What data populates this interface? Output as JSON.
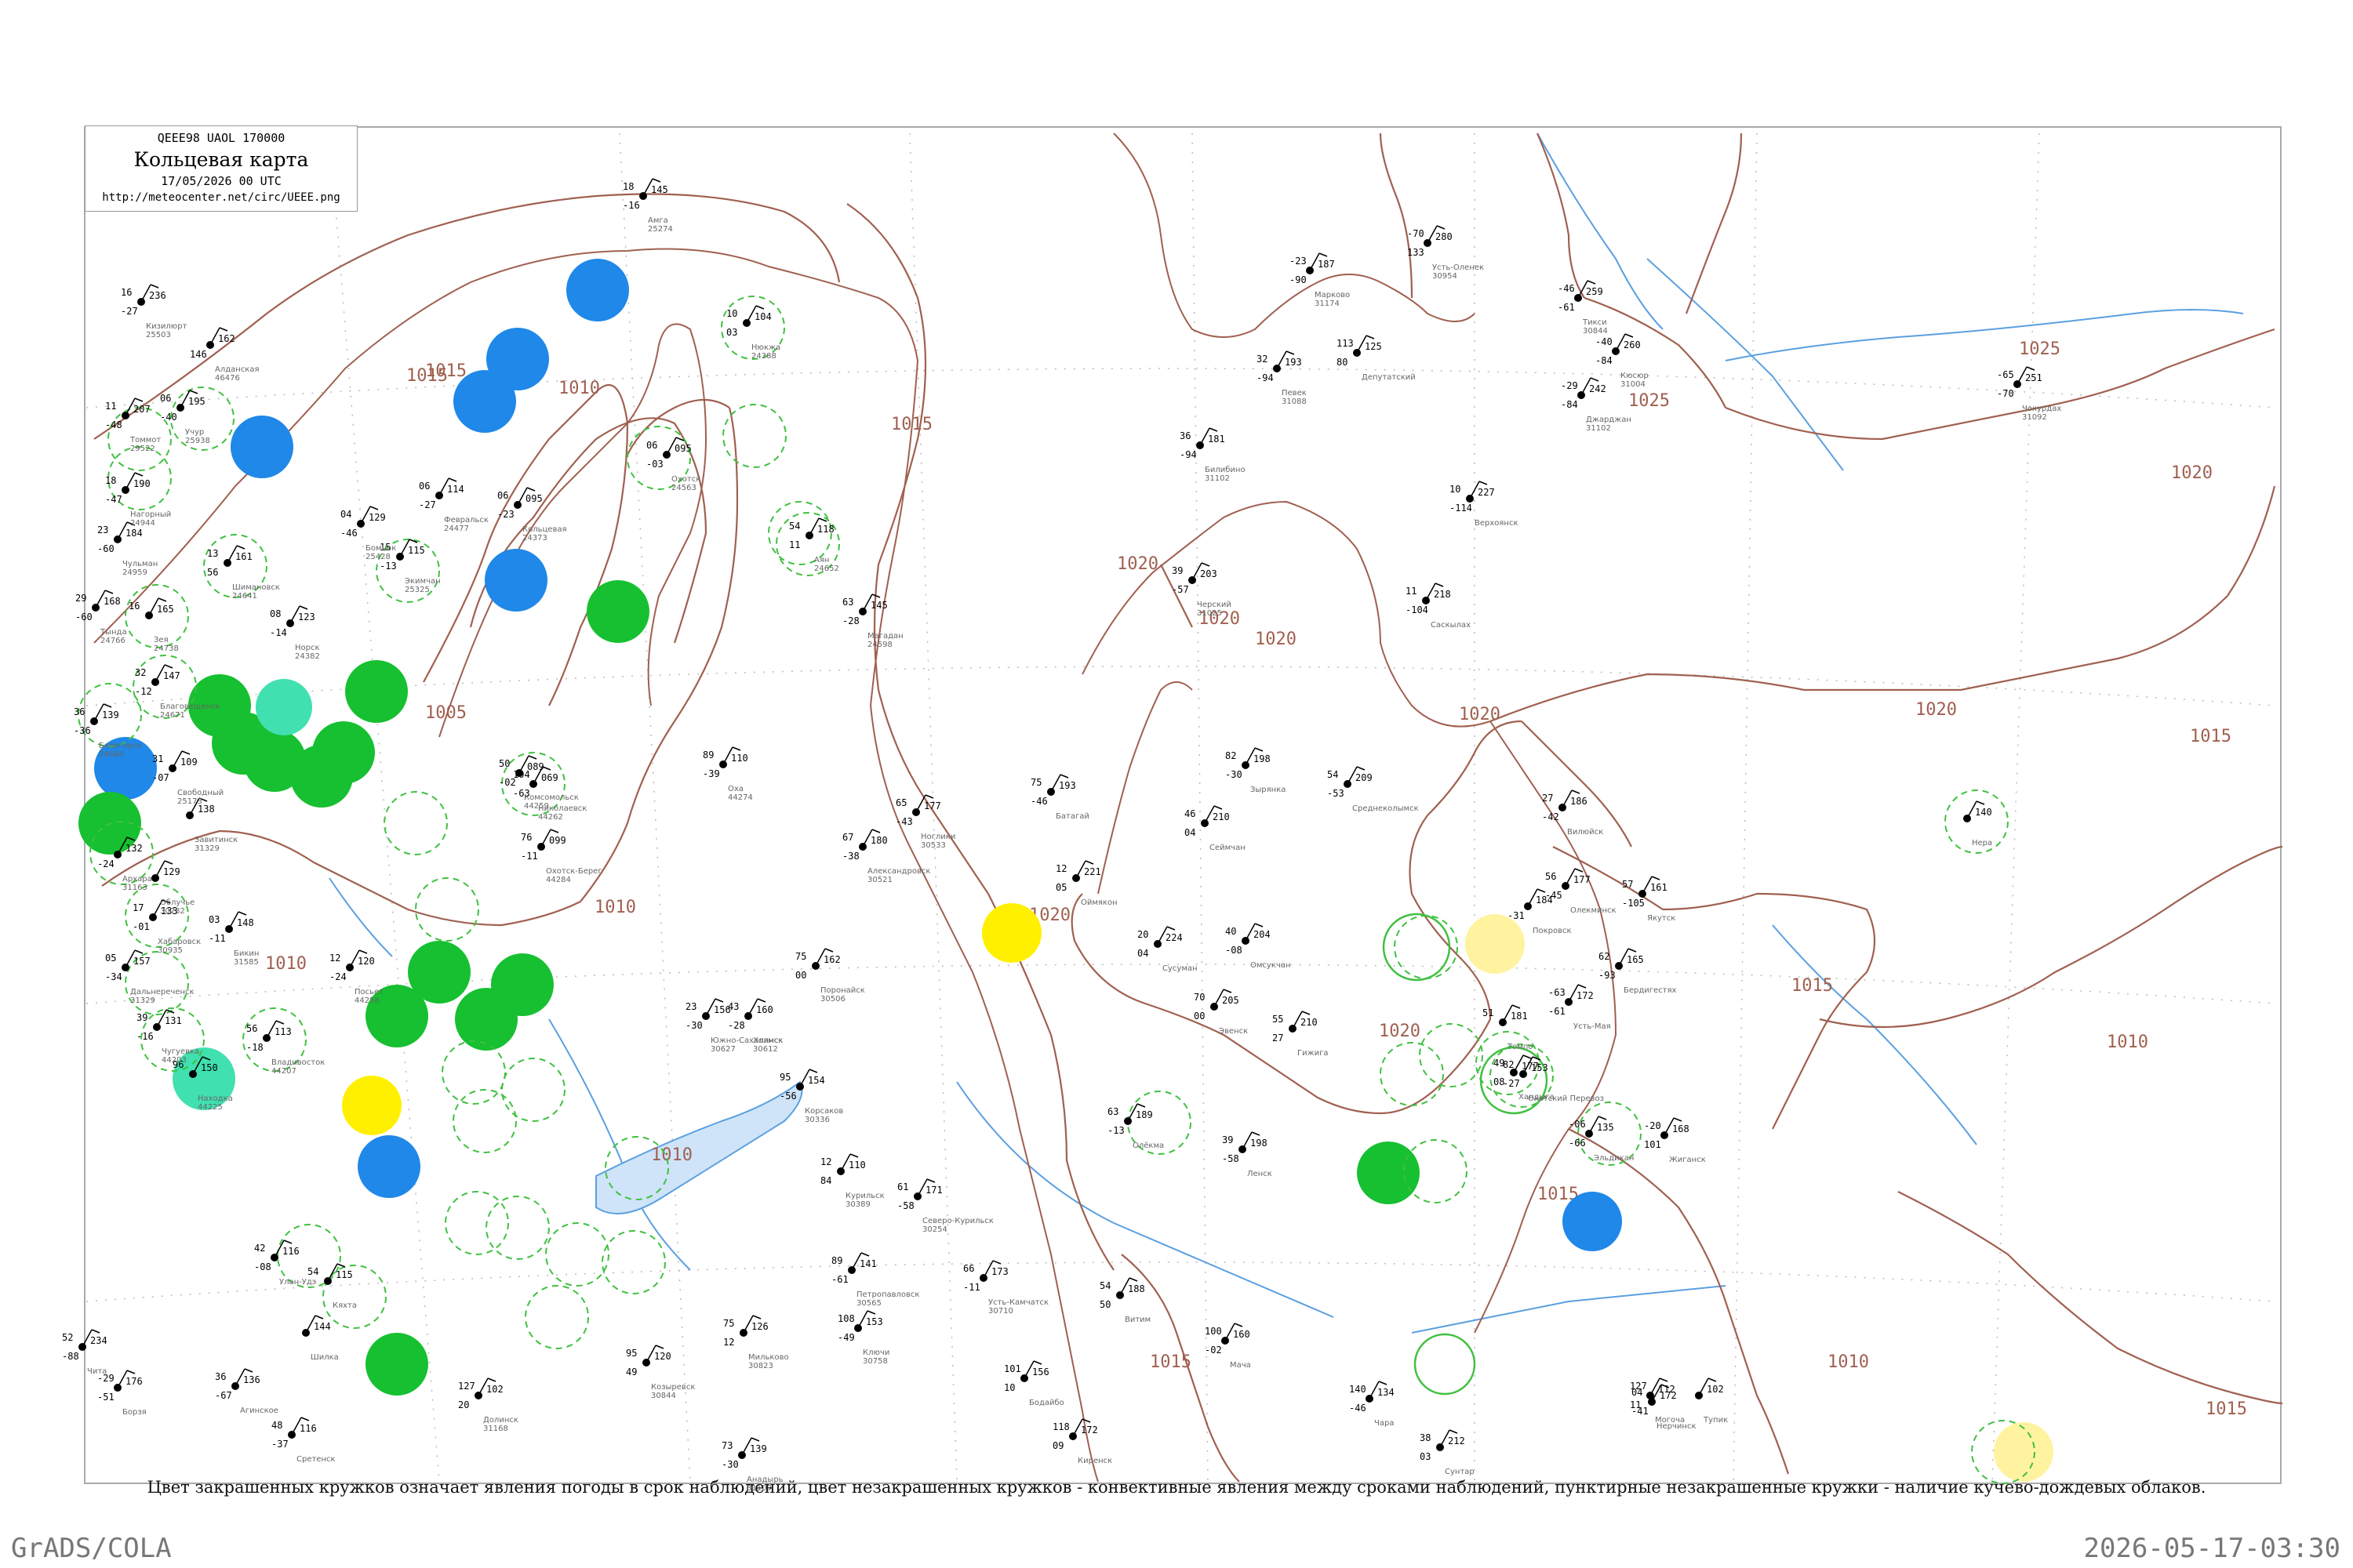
{
  "header": {
    "code_line": "QEEE98  UAOL  170000",
    "title": "Кольцевая карта",
    "date": "17/05/2026 00 UTC",
    "url": "http://meteocenter.net/circ/UEEE.png"
  },
  "legend_text": "Цвет закрашенных кружков означает явления погоды в срок наблюдений, цвет незакрашенных кружков - конвективные явления между сроками наблюдений, пунктирные незакрашенные кружки - наличие кучево-дождевых облаков.",
  "footer": {
    "left": "GrADS/COLA",
    "right": "2026-05-17-03:30"
  },
  "colors": {
    "isobar": "#a06050",
    "water": "#5aa0e0",
    "rain_green": "#16c030",
    "snow_blue": "#1f88e8",
    "fog_yellow": "#fff000",
    "haze_lightyellow": "#fff3a0",
    "cb_dashed": "#40c040",
    "teal": "#40e0b0"
  },
  "isobar_labels": [
    "1005",
    "1010",
    "1010",
    "1010",
    "1015",
    "1015",
    "1020",
    "1020",
    "1020",
    "1020",
    "1020",
    "1020",
    "1015",
    "1010",
    "1020",
    "1025",
    "1025",
    "1020",
    "1015",
    "1015",
    "1015",
    "1010",
    "1010",
    "1015",
    "1015"
  ],
  "stations": [
    {
      "name": "Амга",
      "pressure": "145",
      "temp": "18",
      "dew": "-16"
    },
    {
      "name": "Кизилюрт",
      "pressure": "236",
      "temp": "16",
      "dew": "-27"
    },
    {
      "name": "Алданская",
      "pressure": "162",
      "temp": "",
      "dew": "146"
    },
    {
      "name": "Томмот",
      "pressure": "207",
      "temp": "11",
      "dew": "-48"
    },
    {
      "name": "Учур",
      "pressure": "195",
      "temp": "06",
      "dew": "-40"
    },
    {
      "name": "Нагорный",
      "pressure": "190",
      "temp": "18",
      "dew": "-47"
    },
    {
      "name": "Чульман",
      "pressure": "184",
      "temp": "23",
      "dew": "-60"
    },
    {
      "name": "Тында",
      "pressure": "168",
      "temp": "29",
      "dew": "-60"
    },
    {
      "name": "Зея",
      "pressure": "165",
      "temp": "16",
      "dew": ""
    },
    {
      "name": "Шимановск",
      "pressure": "161",
      "temp": "13",
      "dew": "56"
    },
    {
      "name": "Бомнак",
      "pressure": "129",
      "temp": "04",
      "dew": "-46"
    },
    {
      "name": "Экимчан",
      "pressure": "115",
      "temp": "15",
      "dew": "-13"
    },
    {
      "name": "Норск",
      "pressure": "123",
      "temp": "08",
      "dew": "-14"
    },
    {
      "name": "Февральск",
      "pressure": "114",
      "temp": "06",
      "dew": "-27"
    },
    {
      "name": "Кольцевая",
      "pressure": "095",
      "temp": "06",
      "dew": "-23"
    },
    {
      "name": "Нюкжа",
      "pressure": "104",
      "temp": "10",
      "dew": "03"
    },
    {
      "name": "Охотск",
      "pressure": "095",
      "temp": "06",
      "dew": "-03"
    },
    {
      "name": "Аян",
      "pressure": "118",
      "temp": "54",
      "dew": "11"
    },
    {
      "name": "Магадан",
      "pressure": "145",
      "temp": "63",
      "dew": "-28"
    },
    {
      "name": "Благовещенск",
      "pressure": "147",
      "temp": "32",
      "dew": "-12"
    },
    {
      "name": "Белогорск",
      "pressure": "139",
      "temp": "36",
      "dew": "-36"
    },
    {
      "name": "Свободный",
      "pressure": "109",
      "temp": "31",
      "dew": "-07"
    },
    {
      "name": "Завитинск",
      "pressure": "138",
      "temp": "",
      "dew": ""
    },
    {
      "name": "Архара",
      "pressure": "132",
      "temp": "",
      "dew": "-24"
    },
    {
      "name": "Облучье",
      "pressure": "129",
      "temp": "",
      "dew": ""
    },
    {
      "name": "Хабаровск",
      "pressure": "133",
      "temp": "17",
      "dew": "-01"
    },
    {
      "name": "Бикин",
      "pressure": "148",
      "temp": "03",
      "dew": "-11"
    },
    {
      "name": "Дальнереченск",
      "pressure": "157",
      "temp": "05",
      "dew": "-34"
    },
    {
      "name": "Чугуевка",
      "pressure": "131",
      "temp": "39",
      "dew": "-16"
    },
    {
      "name": "Владивосток",
      "pressure": "113",
      "temp": "56",
      "dew": "-18"
    },
    {
      "name": "Находка",
      "pressure": "150",
      "temp": "96",
      "dew": ""
    },
    {
      "name": "Посьет",
      "pressure": "120",
      "temp": "12",
      "dew": "-24"
    },
    {
      "name": "Комсомольск",
      "pressure": "089",
      "temp": "50",
      "dew": "-02"
    },
    {
      "name": "Николаевск",
      "pressure": "069",
      "temp": "104",
      "dew": "-63"
    },
    {
      "name": "Охотск-Берег",
      "pressure": "099",
      "temp": "76",
      "dew": "-11"
    },
    {
      "name": "Оха",
      "pressure": "110",
      "temp": "89",
      "dew": "-39"
    },
    {
      "name": "Ноглики",
      "pressure": "177",
      "temp": "65",
      "dew": "-43"
    },
    {
      "name": "Александровск",
      "pressure": "180",
      "temp": "67",
      "dew": "-38"
    },
    {
      "name": "Поронайск",
      "pressure": "162",
      "temp": "75",
      "dew": "00"
    },
    {
      "name": "Холмск",
      "pressure": "160",
      "temp": "43",
      "dew": "-28"
    },
    {
      "name": "Южно-Сахалинск",
      "pressure": "156",
      "temp": "23",
      "dew": "-30"
    },
    {
      "name": "Корсаков",
      "pressure": "154",
      "temp": "95",
      "dew": "-56"
    },
    {
      "name": "Курильск",
      "pressure": "110",
      "temp": "12",
      "dew": "84"
    },
    {
      "name": "Северо-Курильск",
      "pressure": "171",
      "temp": "61",
      "dew": "-58"
    },
    {
      "name": "Петропавловск",
      "pressure": "141",
      "temp": "89",
      "dew": "-61"
    },
    {
      "name": "Усть-Камчатск",
      "pressure": "173",
      "temp": "66",
      "dew": "-11"
    },
    {
      "name": "Ключи",
      "pressure": "153",
      "temp": "108",
      "dew": "-49"
    },
    {
      "name": "Мильково",
      "pressure": "126",
      "temp": "75",
      "dew": "12"
    },
    {
      "name": "Козыревск",
      "pressure": "120",
      "temp": "95",
      "dew": "49"
    },
    {
      "name": "Долинск",
      "pressure": "102",
      "temp": "127",
      "dew": "20"
    },
    {
      "name": "Анадырь",
      "pressure": "139",
      "temp": "73",
      "dew": "-30"
    },
    {
      "name": "Марково",
      "pressure": "187",
      "temp": "-23",
      "dew": "-90"
    },
    {
      "name": "Певек",
      "pressure": "193",
      "temp": "32",
      "dew": "-94"
    },
    {
      "name": "Билибино",
      "pressure": "181",
      "temp": "36",
      "dew": "-94"
    },
    {
      "name": "Черский",
      "pressure": "203",
      "temp": "39",
      "dew": "-57"
    },
    {
      "name": "Усть-Оленек",
      "pressure": "280",
      "temp": "-70",
      "dew": "133"
    },
    {
      "name": "Тикси",
      "pressure": "259",
      "temp": "-46",
      "dew": "-61"
    },
    {
      "name": "Кюсюр",
      "pressure": "260",
      "temp": "-40",
      "dew": "-84"
    },
    {
      "name": "Джарджан",
      "pressure": "242",
      "temp": "-29",
      "dew": "-84"
    },
    {
      "name": "Чокурдах",
      "pressure": "251",
      "temp": "-65",
      "dew": "-70"
    },
    {
      "name": "Депутатский",
      "pressure": "125",
      "temp": "113",
      "dew": "80"
    },
    {
      "name": "Верхоянск",
      "pressure": "227",
      "temp": "10",
      "dew": "-114"
    },
    {
      "name": "Саскылах",
      "pressure": "218",
      "temp": "11",
      "dew": "-104"
    },
    {
      "name": "Батагай",
      "pressure": "193",
      "temp": "75",
      "dew": "-46"
    },
    {
      "name": "Зырянка",
      "pressure": "198",
      "temp": "82",
      "dew": "-30"
    },
    {
      "name": "Среднеколымск",
      "pressure": "209",
      "temp": "54",
      "dew": "-53"
    },
    {
      "name": "Сеймчан",
      "pressure": "210",
      "temp": "46",
      "dew": "04"
    },
    {
      "name": "Оймякон",
      "pressure": "221",
      "temp": "12",
      "dew": "05"
    },
    {
      "name": "Сусуман",
      "pressure": "224",
      "temp": "20",
      "dew": "04"
    },
    {
      "name": "Омсукчан",
      "pressure": "204",
      "temp": "40",
      "dew": "-08"
    },
    {
      "name": "Эвенск",
      "pressure": "205",
      "temp": "70",
      "dew": "00"
    },
    {
      "name": "Гижига",
      "pressure": "210",
      "temp": "55",
      "dew": "27"
    },
    {
      "name": "Вилюйск",
      "pressure": "186",
      "temp": "27",
      "dew": "-42"
    },
    {
      "name": "Олекминск",
      "pressure": "177",
      "temp": "56",
      "dew": "-45"
    },
    {
      "name": "Якутск",
      "pressure": "161",
      "temp": "57",
      "dew": "-105"
    },
    {
      "name": "Покровск",
      "pressure": "184",
      "temp": "",
      "dew": "-31"
    },
    {
      "name": "Бердигестях",
      "pressure": "165",
      "temp": "62",
      "dew": "-93"
    },
    {
      "name": "Усть-Мая",
      "pressure": "172",
      "temp": "-63",
      "dew": "-61"
    },
    {
      "name": "Томпо",
      "pressure": "181",
      "temp": "51",
      "dew": ""
    },
    {
      "name": "Хандыга",
      "pressure": "177",
      "temp": "49",
      "dew": "08"
    },
    {
      "name": "Охотский Перевоз",
      "pressure": "153",
      "temp": "82",
      "dew": "-27"
    },
    {
      "name": "Эльдикан",
      "pressure": "135",
      "temp": "-06",
      "dew": "-66"
    },
    {
      "name": "Жиганск",
      "pressure": "168",
      "temp": "-20",
      "dew": "101"
    },
    {
      "name": "Нера",
      "pressure": "140",
      "temp": "",
      "dew": ""
    },
    {
      "name": "Сунтар",
      "pressure": "212",
      "temp": "38",
      "dew": "03"
    },
    {
      "name": "Ленск",
      "pressure": "198",
      "temp": "39",
      "dew": "-58"
    },
    {
      "name": "Олёкма",
      "pressure": "189",
      "temp": "63",
      "dew": "-13"
    },
    {
      "name": "Витим",
      "pressure": "188",
      "temp": "54",
      "dew": "50"
    },
    {
      "name": "Мача",
      "pressure": "160",
      "temp": "100",
      "dew": "-02"
    },
    {
      "name": "Бодайбо",
      "pressure": "156",
      "temp": "101",
      "dew": "10"
    },
    {
      "name": "Киренск",
      "pressure": "172",
      "temp": "118",
      "dew": "09"
    },
    {
      "name": "Чара",
      "pressure": "134",
      "temp": "140",
      "dew": "-46"
    },
    {
      "name": "Могоча",
      "pressure": "112",
      "temp": "127",
      "dew": "11"
    },
    {
      "name": "Тупик",
      "pressure": "102",
      "temp": "",
      "dew": ""
    },
    {
      "name": "Нерчинск",
      "pressure": "172",
      "temp": "04",
      "dew": "-41"
    },
    {
      "name": "Чита",
      "pressure": "234",
      "temp": "52",
      "dew": "-88"
    },
    {
      "name": "Борзя",
      "pressure": "176",
      "temp": "-29",
      "dew": "-51"
    },
    {
      "name": "Агинское",
      "pressure": "136",
      "temp": "36",
      "dew": "-67"
    },
    {
      "name": "Сретенск",
      "pressure": "116",
      "temp": "48",
      "dew": "-37"
    },
    {
      "name": "Шилка",
      "pressure": "144",
      "temp": "",
      "dew": ""
    },
    {
      "name": "Улан-Удэ",
      "pressure": "116",
      "temp": "42",
      "dew": "-08"
    },
    {
      "name": "Кяхта",
      "pressure": "115",
      "temp": "54",
      "dew": ""
    }
  ],
  "station_ids": [
    "25274",
    "25503",
    "46476",
    "29522",
    "25938",
    "24944",
    "24959",
    "24766",
    "24738",
    "24641",
    "25428",
    "25325",
    "24382",
    "24477",
    "24373",
    "24388",
    "24563",
    "24652",
    "24598",
    "24671",
    "24684",
    "25173",
    "31329",
    "31163",
    "30782",
    "30935",
    "31585",
    "31329",
    "44203",
    "44207",
    "44225",
    "44258",
    "44259",
    "44262",
    "44284",
    "44274",
    "30533",
    "30521",
    "30506",
    "30612",
    "30627",
    "30336",
    "30389",
    "30254",
    "30565",
    "30710",
    "30758",
    "30823",
    "30844",
    "31168",
    "31109",
    "31174",
    "31088",
    "31102",
    "31025",
    "30954",
    "30844",
    "31004",
    "31102",
    "31092"
  ]
}
